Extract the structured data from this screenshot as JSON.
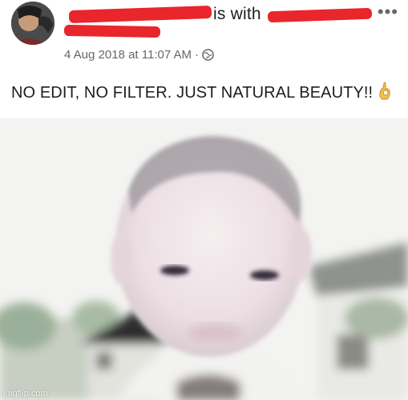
{
  "post": {
    "with_text": "is with",
    "timestamp": "4 Aug 2018 at 11:07 AM",
    "separator": "·",
    "audience_icon": "globe-icon",
    "more_icon": "more-horizontal-icon",
    "caption": "NO EDIT, NO FILTER. JUST NATURAL BEAUTY!!",
    "caption_emoji": "ok-hand-emoji"
  },
  "watermark": "imgflip.com",
  "colors": {
    "redaction": "#e8262b",
    "text": "#1c1e21",
    "meta": "#65676b"
  }
}
